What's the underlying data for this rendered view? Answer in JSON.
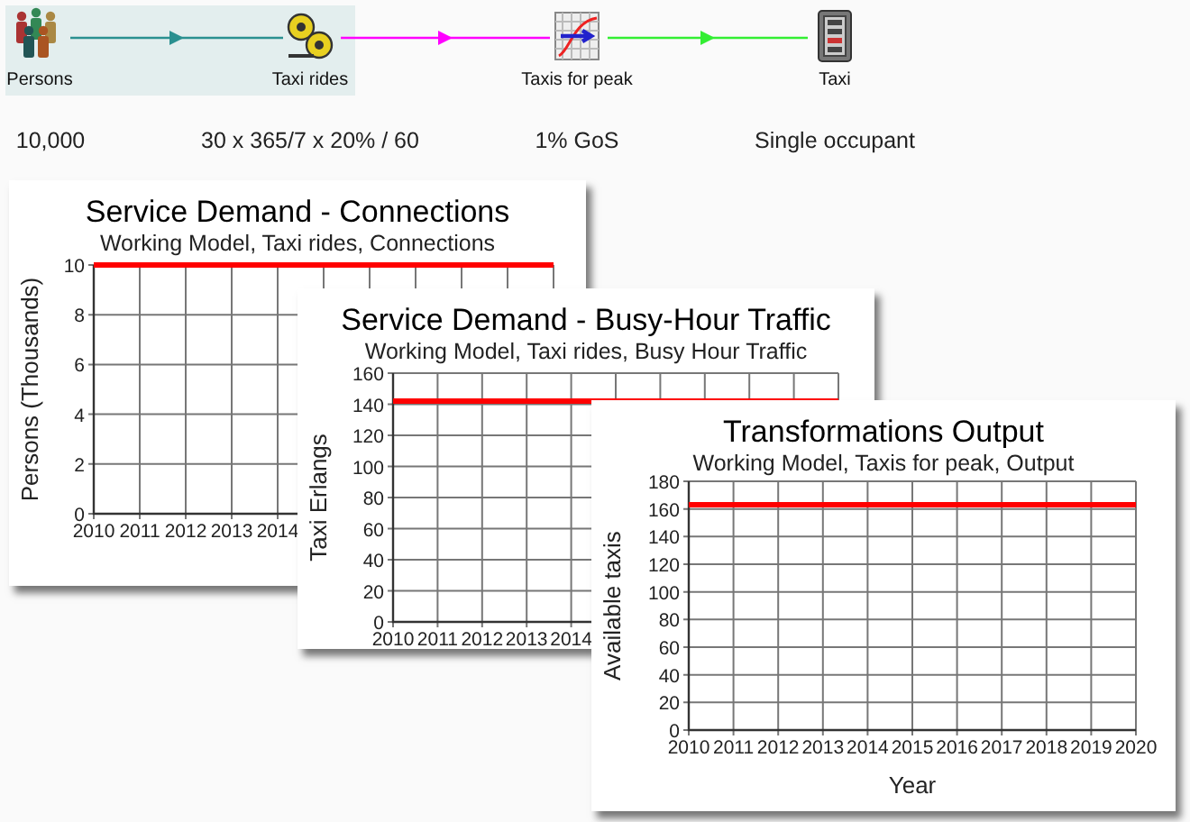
{
  "diagram": {
    "nodes": [
      {
        "label": "Persons",
        "kind": "people",
        "value": "10,000"
      },
      {
        "label": "Taxi rides",
        "kind": "gears",
        "value": "30 x 365/7 x 20% / 60"
      },
      {
        "label": "Taxis for peak",
        "kind": "graph",
        "value": "1% GoS"
      },
      {
        "label": "Taxi",
        "kind": "cabinet",
        "value": "Single occupant"
      }
    ],
    "links": [
      {
        "color": "#2a9090"
      },
      {
        "color": "#ff00ff"
      },
      {
        "color": "#33ee33"
      }
    ]
  },
  "charts": [
    {
      "subtitle": "Working Model, Taxi rides, Connections",
      "chart_data": {
        "type": "line",
        "title": "Service Demand - Connections",
        "ylabel": "Persons  (Thousands)",
        "x": [
          2010,
          2011,
          2012,
          2013,
          2014,
          2015,
          2016,
          2017,
          2018,
          2019,
          2020
        ],
        "xlim": [
          2010,
          2020
        ],
        "ylim": [
          0,
          10
        ],
        "xticks": [
          2010,
          2011,
          2012,
          2013,
          2014
        ],
        "yticks": [
          0,
          2,
          4,
          6,
          8,
          10
        ],
        "grid": true,
        "series": [
          {
            "color": "#ff0000",
            "values": [
              10,
              10,
              10,
              10,
              10,
              10,
              10,
              10,
              10,
              10,
              10
            ]
          }
        ]
      }
    },
    {
      "subtitle": "Working Model, Taxi rides, Busy Hour Traffic",
      "chart_data": {
        "type": "line",
        "title": "Service Demand - Busy-Hour Traffic",
        "ylabel": "Taxi Erlangs",
        "x": [
          2010,
          2011,
          2012,
          2013,
          2014,
          2015,
          2016,
          2017,
          2018,
          2019,
          2020
        ],
        "xlim": [
          2010,
          2020
        ],
        "ylim": [
          0,
          160
        ],
        "xticks": [
          2010,
          2011,
          2012,
          2013,
          2014
        ],
        "yticks": [
          0,
          20,
          40,
          60,
          80,
          100,
          120,
          140,
          160
        ],
        "grid": true,
        "series": [
          {
            "color": "#ff0000",
            "values": [
              142,
              142,
              142,
              142,
              142,
              142,
              142,
              142,
              142,
              142,
              142
            ]
          }
        ]
      }
    },
    {
      "subtitle": "Working Model, Taxis for peak, Output",
      "chart_data": {
        "type": "line",
        "title": "Transformations Output",
        "xlabel": "Year",
        "ylabel": "Available taxis",
        "x": [
          2010,
          2011,
          2012,
          2013,
          2014,
          2015,
          2016,
          2017,
          2018,
          2019,
          2020
        ],
        "xlim": [
          2010,
          2020
        ],
        "ylim": [
          0,
          180
        ],
        "xticks": [
          2010,
          2011,
          2012,
          2013,
          2014,
          2015,
          2016,
          2017,
          2018,
          2019,
          2020
        ],
        "yticks": [
          0,
          20,
          40,
          60,
          80,
          100,
          120,
          140,
          160,
          180
        ],
        "grid": true,
        "series": [
          {
            "color": "#ff0000",
            "values": [
              163,
              163,
              163,
              163,
              163,
              163,
              163,
              163,
              163,
              163,
              163
            ]
          }
        ]
      }
    }
  ]
}
